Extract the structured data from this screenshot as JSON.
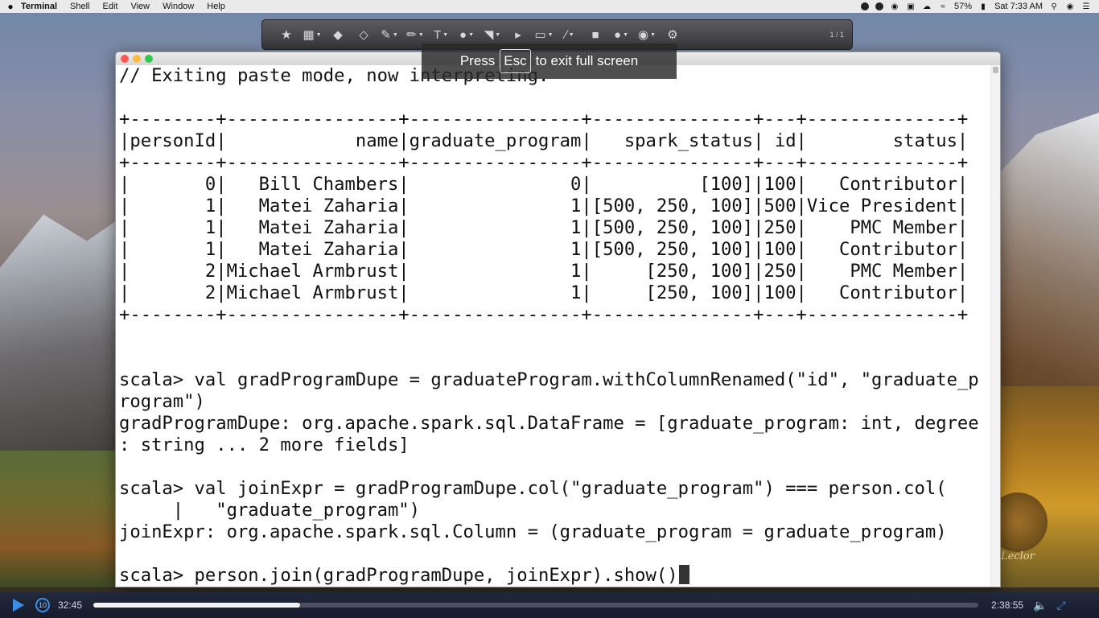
{
  "menubar": {
    "apple": "",
    "app_name": "Terminal",
    "menus": [
      "Shell",
      "Edit",
      "View",
      "Window",
      "Help"
    ],
    "battery": "57%",
    "clock": "Sat 7:33 AM"
  },
  "toolbar": {
    "page_indicator": "1 / 1"
  },
  "fullscreen_hint": {
    "press": "Press",
    "key": "Esc",
    "rest": "to exit full screen"
  },
  "terminal": {
    "lines": [
      "// Exiting paste mode, now interpreting.",
      "",
      "+--------+----------------+----------------+---------------+---+--------------+",
      "|personId|            name|graduate_program|   spark_status| id|        status|",
      "+--------+----------------+----------------+---------------+---+--------------+",
      "|       0|   Bill Chambers|               0|          [100]|100|   Contributor|",
      "|       1|   Matei Zaharia|               1|[500, 250, 100]|500|Vice President|",
      "|       1|   Matei Zaharia|               1|[500, 250, 100]|250|    PMC Member|",
      "|       1|   Matei Zaharia|               1|[500, 250, 100]|100|   Contributor|",
      "|       2|Michael Armbrust|               1|     [250, 100]|250|    PMC Member|",
      "|       2|Michael Armbrust|               1|     [250, 100]|100|   Contributor|",
      "+--------+----------------+----------------+---------------+---+--------------+",
      "",
      "",
      "scala> val gradProgramDupe = graduateProgram.withColumnRenamed(\"id\", \"graduate_p",
      "rogram\")",
      "gradProgramDupe: org.apache.spark.sql.DataFrame = [graduate_program: int, degree",
      ": string ... 2 more fields]",
      "",
      "scala> val joinExpr = gradProgramDupe.col(\"graduate_program\") === person.col(",
      "     |   \"graduate_program\")",
      "joinExpr: org.apache.spark.sql.Column = (graduate_program = graduate_program)",
      "",
      "scala> person.join(gradProgramDupe, joinExpr).show()"
    ]
  },
  "player": {
    "current_time": "32:45",
    "end_time": "2:38:55",
    "progress": 0.234
  },
  "badge_text": "Leclor"
}
